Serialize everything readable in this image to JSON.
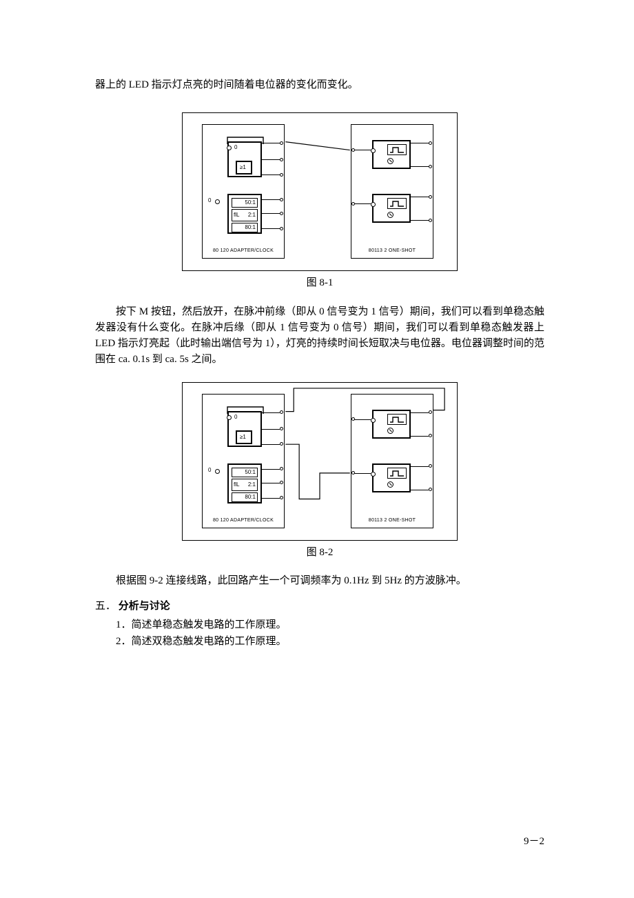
{
  "topLine": "器上的 LED 指示灯点亮的时间随着电位器的变化而变化。",
  "fig1": {
    "caption": "图 8-1",
    "leftModule": "80 120   ADAPTER/CLOCK",
    "rightModule": "80113   2 ONE-SHOT",
    "ge1": "≥1",
    "ratio50": "50:1",
    "ratio2": "2:1",
    "ratio80": "80:1",
    "pulseLabel": "ﬂL"
  },
  "midPara": "按下 M 按钮，然后放开，在脉冲前缘（即从 0 信号变为 1 信号）期间，我们可以看到单稳态触发器没有什么变化。在脉冲后缘（即从 1 信号变为 0 信号）期间，我们可以看到单稳态触发器上 LED 指示灯亮起（此时输出端信号为 1），灯亮的持续时间长短取决与电位器。电位器调整时间的范围在 ca. 0.1s 到 ca. 5s 之间。",
  "fig2": {
    "caption": "图 8-2",
    "leftModule": "80 120   ADAPTER/CLOCK",
    "rightModule": "80113   2 ONE-SHOT",
    "ge1": "≥1",
    "ratio50": "50:1",
    "ratio2": "2:1",
    "ratio80": "80:1"
  },
  "afterFig2": "根据图 9-2 连接线路，此回路产生一个可调频率为 0.1Hz 到 5Hz 的方波脉冲。",
  "sectionHead": {
    "number": "五．",
    "title": "分析与讨论"
  },
  "discussion": [
    "1．简述单稳态触发电路的工作原理。",
    "2．简述双稳态触发电路的工作原理。"
  ],
  "pageNumber": "9－2"
}
